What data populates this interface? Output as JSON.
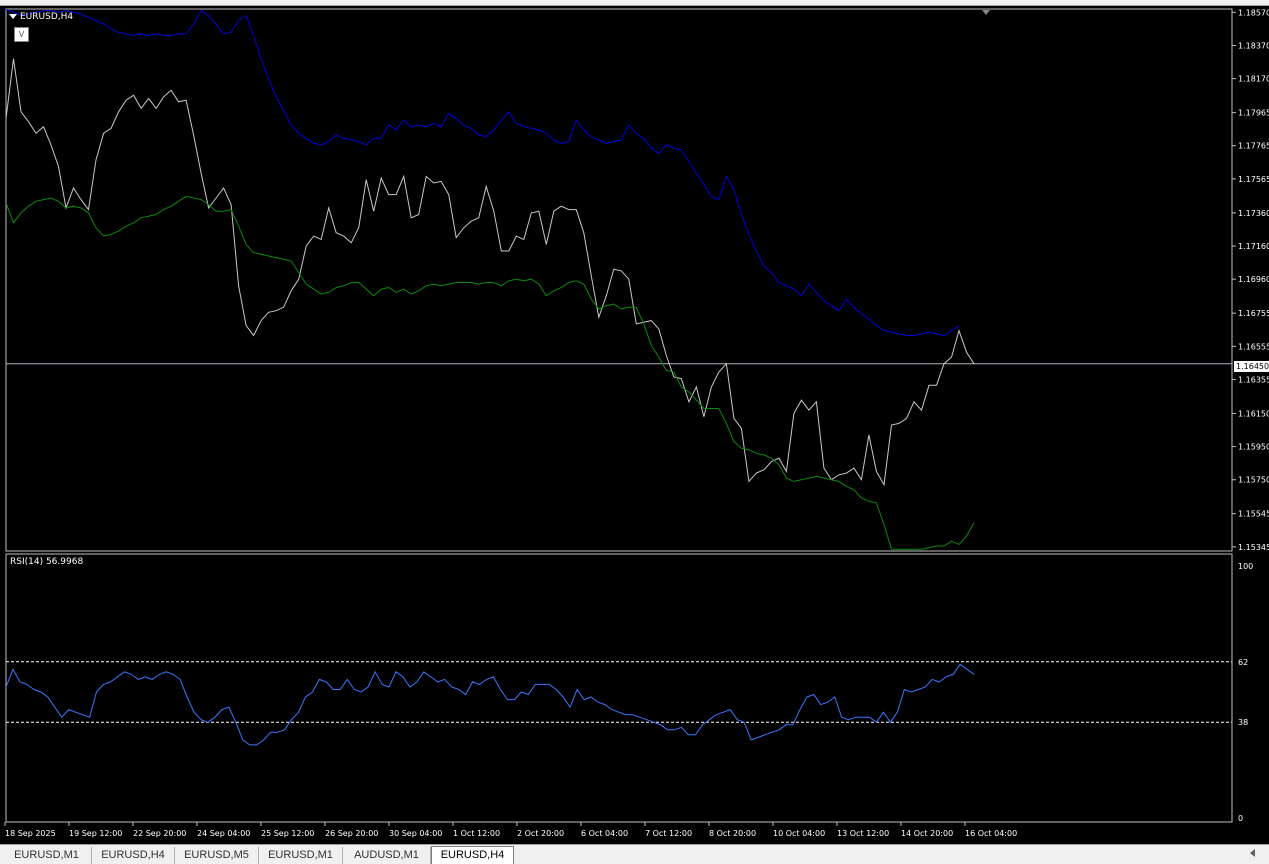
{
  "window": {
    "symbol_label": "EURUSD,H4",
    "v_button": "V",
    "rsi_label": "RSI(14) 56.9968",
    "current_price": "1.16450"
  },
  "tabs": [
    {
      "label": "EURUSD,M1",
      "active": false
    },
    {
      "label": "EURUSD,H4",
      "active": false
    },
    {
      "label": "EURUSD,M5",
      "active": false
    },
    {
      "label": "EURUSD,M1",
      "active": false
    },
    {
      "label": "AUDUSD,M1",
      "active": false
    },
    {
      "label": "EURUSD,H4",
      "active": true
    }
  ],
  "colors": {
    "background": "#000000",
    "price_line": "#c8c8c8",
    "upper_band": "#0000e0",
    "moving_average": "#0a8a0a",
    "rsi": "#3a78ff",
    "grid": "#ffffff"
  },
  "chart_data": [
    {
      "type": "line",
      "panel": "price",
      "symbol": "EURUSD",
      "timeframe": "H4",
      "y_ticks": [
        "1.18570",
        "1.18370",
        "1.18170",
        "1.17965",
        "1.17765",
        "1.17565",
        "1.17360",
        "1.17160",
        "1.16960",
        "1.16755",
        "1.16555",
        "1.16355",
        "1.16150",
        "1.15950",
        "1.15750",
        "1.15545",
        "1.15345"
      ],
      "ylim": [
        1.1532,
        1.1859
      ],
      "x_ticks": [
        "18 Sep 2025",
        "19 Sep 12:00",
        "22 Sep 20:00",
        "24 Sep 04:00",
        "25 Sep 12:00",
        "26 Sep 20:00",
        "30 Sep 04:00",
        "1 Oct 12:00",
        "2 Oct 20:00",
        "6 Oct 04:00",
        "7 Oct 12:00",
        "8 Oct 20:00",
        "10 Oct 04:00",
        "13 Oct 12:00",
        "14 Oct 20:00",
        "16 Oct 04:00"
      ],
      "current_price": 1.1645,
      "series": [
        {
          "values": [
            1.1793,
            1.1829,
            1.1797,
            1.1791,
            1.1784,
            1.1788,
            1.1777,
            1.1764,
            1.1739,
            1.1751,
            1.1744,
            1.1738,
            1.1768,
            1.1784,
            1.1787,
            1.1797,
            1.1804,
            1.1807,
            1.1799,
            1.1805,
            1.1799,
            1.1806,
            1.181,
            1.1803,
            1.1804,
            1.1783,
            1.176,
            1.1739,
            1.1745,
            1.1751,
            1.1741,
            1.1692,
            1.1668,
            1.1662,
            1.1671,
            1.1676,
            1.1677,
            1.1679,
            1.1689,
            1.1696,
            1.1716,
            1.1722,
            1.172,
            1.1739,
            1.1724,
            1.1722,
            1.1718,
            1.1727,
            1.1756,
            1.1737,
            1.1757,
            1.1747,
            1.1747,
            1.1758,
            1.1733,
            1.1735,
            1.1758,
            1.1754,
            1.1755,
            1.1747,
            1.1721,
            1.1727,
            1.1731,
            1.1733,
            1.1752,
            1.1737,
            1.1713,
            1.1713,
            1.1722,
            1.172,
            1.1736,
            1.1737,
            1.1717,
            1.1737,
            1.174,
            1.1738,
            1.1738,
            1.1724,
            1.1698,
            1.1673,
            1.1686,
            1.1702,
            1.1701,
            1.1696,
            1.1669,
            1.167,
            1.1671,
            1.1666,
            1.165,
            1.1637,
            1.1636,
            1.1622,
            1.1631,
            1.1613,
            1.1631,
            1.164,
            1.1645,
            1.1612,
            1.1606,
            1.1574,
            1.1579,
            1.1581,
            1.1586,
            1.1588,
            1.158,
            1.1615,
            1.1623,
            1.1617,
            1.1622,
            1.1582,
            1.1575,
            1.1578,
            1.1579,
            1.1582,
            1.1575,
            1.1602,
            1.158,
            1.1572,
            1.1608,
            1.1609,
            1.1612,
            1.1622,
            1.1617,
            1.1632,
            1.1632,
            1.1645,
            1.1649,
            1.1665,
            1.1652,
            1.1645
          ]
        },
        {
          "values": [
            1.1859,
            1.1857,
            1.1855,
            1.1856,
            1.1857,
            1.1858,
            1.1858,
            1.1857,
            1.1858,
            1.1857,
            1.1856,
            1.1854,
            1.1852,
            1.185,
            1.1847,
            1.1845,
            1.1844,
            1.1843,
            1.1844,
            1.1843,
            1.1844,
            1.1843,
            1.1843,
            1.1844,
            1.1844,
            1.185,
            1.1858,
            1.1855,
            1.185,
            1.1844,
            1.1845,
            1.1852,
            1.1855,
            1.1843,
            1.1829,
            1.1817,
            1.1806,
            1.1798,
            1.1789,
            1.1784,
            1.1781,
            1.1778,
            1.1777,
            1.1779,
            1.1783,
            1.1781,
            1.178,
            1.1779,
            1.1777,
            1.1781,
            1.1781,
            1.1789,
            1.1786,
            1.1792,
            1.1788,
            1.1789,
            1.1788,
            1.179,
            1.1788,
            1.1796,
            1.1793,
            1.1789,
            1.1787,
            1.1783,
            1.1782,
            1.1786,
            1.1792,
            1.1797,
            1.179,
            1.1788,
            1.1787,
            1.1786,
            1.1784,
            1.178,
            1.1778,
            1.1779,
            1.1792,
            1.1786,
            1.1782,
            1.178,
            1.1778,
            1.1779,
            1.178,
            1.1789,
            1.1784,
            1.1781,
            1.1775,
            1.1772,
            1.1777,
            1.1775,
            1.1774,
            1.1767,
            1.176,
            1.1753,
            1.1746,
            1.1744,
            1.1758,
            1.175,
            1.1735,
            1.1723,
            1.1713,
            1.1704,
            1.17,
            1.1694,
            1.1692,
            1.169,
            1.1686,
            1.1693,
            1.1688,
            1.1683,
            1.168,
            1.1677,
            1.1684,
            1.1679,
            1.1675,
            1.1672,
            1.1668,
            1.1665,
            1.1664,
            1.1663,
            1.1662,
            1.1662,
            1.1663,
            1.1664,
            1.1663,
            1.1662,
            1.1665,
            1.1668
          ]
        },
        {
          "values": [
            1.1742,
            1.173,
            1.1736,
            1.174,
            1.1743,
            1.1744,
            1.1745,
            1.1743,
            1.1739,
            1.174,
            1.1739,
            1.1736,
            1.1727,
            1.1722,
            1.1723,
            1.1725,
            1.1728,
            1.173,
            1.1733,
            1.1734,
            1.1735,
            1.1738,
            1.174,
            1.1743,
            1.1746,
            1.1745,
            1.1744,
            1.1741,
            1.1737,
            1.1737,
            1.1738,
            1.1728,
            1.1717,
            1.1712,
            1.1711,
            1.171,
            1.1709,
            1.1708,
            1.1707,
            1.17,
            1.1693,
            1.169,
            1.1687,
            1.1688,
            1.1691,
            1.1692,
            1.1694,
            1.1694,
            1.169,
            1.1686,
            1.169,
            1.1691,
            1.1688,
            1.169,
            1.1687,
            1.1689,
            1.1692,
            1.1693,
            1.1692,
            1.1693,
            1.1694,
            1.1694,
            1.1694,
            1.1693,
            1.1694,
            1.1694,
            1.1692,
            1.1695,
            1.1696,
            1.1695,
            1.1696,
            1.1693,
            1.1686,
            1.1689,
            1.1691,
            1.1694,
            1.1695,
            1.1693,
            1.1684,
            1.1678,
            1.168,
            1.1681,
            1.1678,
            1.1679,
            1.1679,
            1.1669,
            1.1656,
            1.1649,
            1.1641,
            1.164,
            1.1631,
            1.1628,
            1.1623,
            1.1618,
            1.1618,
            1.1618,
            1.1609,
            1.1598,
            1.1594,
            1.1593,
            1.1591,
            1.159,
            1.1588,
            1.1584,
            1.1576,
            1.1574,
            1.1575,
            1.1576,
            1.1577,
            1.1576,
            1.1575,
            1.1574,
            1.1571,
            1.1569,
            1.1564,
            1.1562,
            1.1561,
            1.1548,
            1.1533,
            1.1533,
            1.1533,
            1.1533,
            1.1533,
            1.1534,
            1.1535,
            1.1535,
            1.1538,
            1.1536,
            1.1541,
            1.1549
          ]
        }
      ]
    },
    {
      "type": "line",
      "panel": "rsi",
      "title": "RSI(14) 56.9968",
      "ylim": [
        0,
        100
      ],
      "y_ticks": [
        "100",
        "62",
        "38",
        "0"
      ],
      "levels": [
        62,
        38
      ],
      "x_ticks": [
        "18 Sep 2025",
        "19 Sep 12:00",
        "22 Sep 20:00",
        "24 Sep 04:00",
        "25 Sep 12:00",
        "26 Sep 20:00",
        "30 Sep 04:00",
        "1 Oct 12:00",
        "2 Oct 20:00",
        "6 Oct 04:00",
        "7 Oct 12:00",
        "8 Oct 20:00",
        "10 Oct 04:00",
        "13 Oct 12:00",
        "14 Oct 20:00",
        "16 Oct 04:00"
      ],
      "series": [
        {
          "values": [
            52,
            59,
            54,
            53,
            51,
            50,
            48,
            44,
            40,
            43,
            42,
            41,
            40,
            50,
            53,
            54,
            56,
            58,
            57,
            55,
            56,
            55,
            57,
            58,
            57,
            55,
            48,
            42,
            39,
            38,
            40,
            43,
            44,
            38,
            31,
            29,
            29,
            31,
            34,
            34,
            35,
            39,
            42,
            48,
            50,
            55,
            54,
            51,
            51,
            55,
            51,
            50,
            52,
            58,
            53,
            52,
            58,
            56,
            52,
            54,
            58,
            56,
            54,
            55,
            52,
            51,
            49,
            54,
            53,
            55,
            56,
            51,
            47,
            47,
            50,
            49,
            53,
            53,
            53,
            51,
            48,
            44,
            51,
            47,
            48,
            46,
            45,
            43,
            42,
            41,
            41,
            40,
            39,
            38,
            37,
            35,
            35,
            36,
            33,
            33,
            37,
            39,
            41,
            42,
            43,
            39,
            38,
            31,
            32,
            33,
            34,
            35,
            37,
            37,
            43,
            48,
            49,
            45,
            46,
            48,
            40,
            39,
            40,
            40,
            40,
            38,
            42,
            38,
            42,
            51,
            50,
            51,
            52,
            55,
            54,
            56,
            57,
            61,
            59,
            57
          ]
        }
      ]
    }
  ]
}
